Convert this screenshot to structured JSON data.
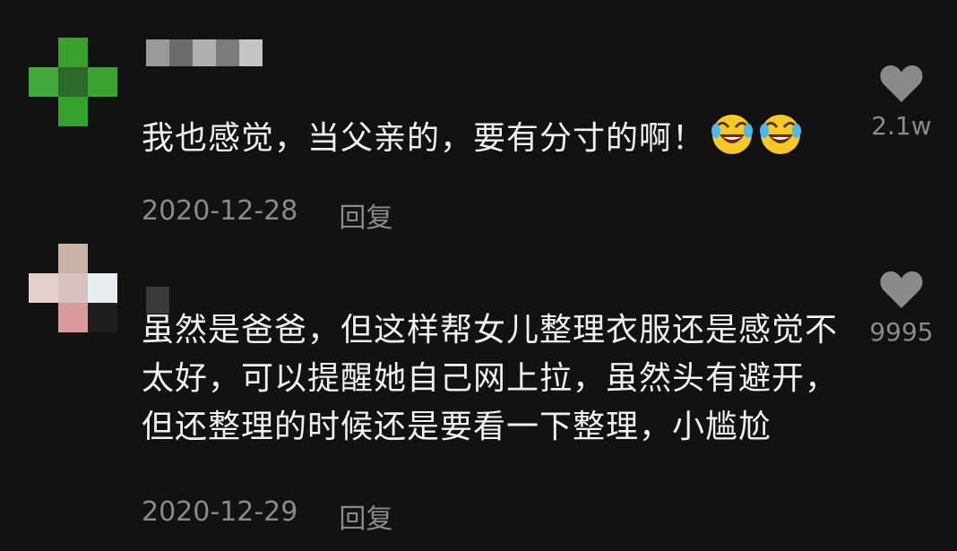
{
  "comments": [
    {
      "text": "我也感觉，当父亲的，要有分寸的啊！",
      "emoji": "laughing-tears-emoji",
      "date": "2020-12-28",
      "reply_label": "回复",
      "likes": "2.1w"
    },
    {
      "text": "虽然是爸爸，但这样帮女儿整理衣服还是感觉不太好，可以提醒她自己网上拉，虽然头有避开，但还整理的时候还是要看一下整理，小尴尬",
      "date": "2020-12-29",
      "reply_label": "回复",
      "likes": "9995"
    }
  ],
  "colors": {
    "background": "#121212",
    "meta_text": "#8a8a8a",
    "heart": "#8a8a8a"
  }
}
